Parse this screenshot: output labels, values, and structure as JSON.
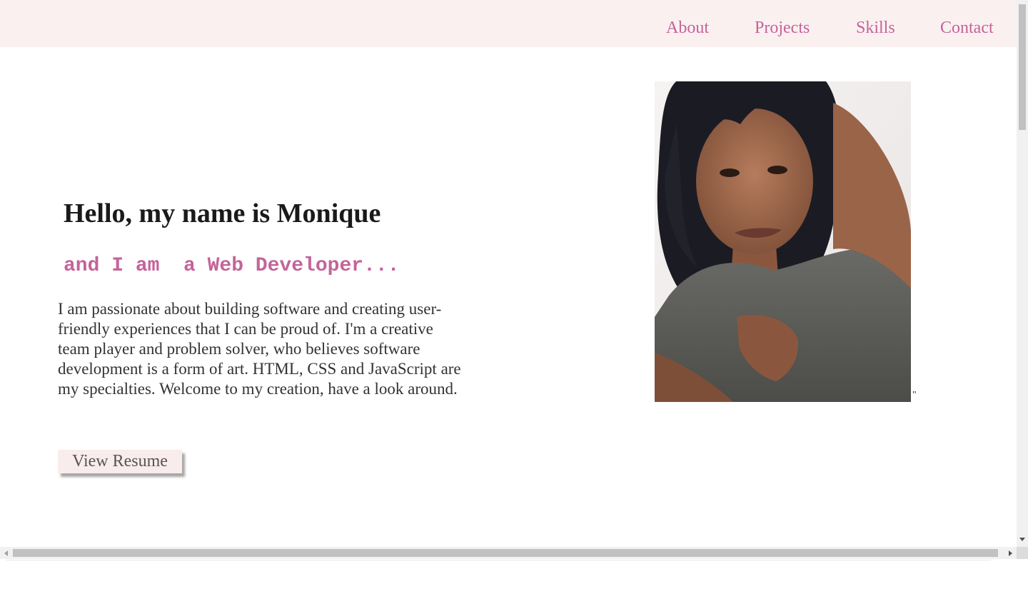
{
  "nav": {
    "items": [
      {
        "label": "About"
      },
      {
        "label": "Projects"
      },
      {
        "label": "Skills"
      },
      {
        "label": "Contact"
      }
    ]
  },
  "hero": {
    "title": "Hello, my name is Monique",
    "subtitle": "and I am  a Web Developer...",
    "description": "I am passionate about building software and creating user-friendly experiences that I can be proud of. I'm a creative team player and problem solver, who believes software development is a form of art. HTML, CSS and JavaScript are my specialties. Welcome to my creation, have a look around.",
    "resume_button": "View Resume",
    "stray_text": "\""
  },
  "colors": {
    "accent": "#c4649a",
    "nav_background": "#fbf0f0",
    "button_background": "#f8ecec"
  }
}
